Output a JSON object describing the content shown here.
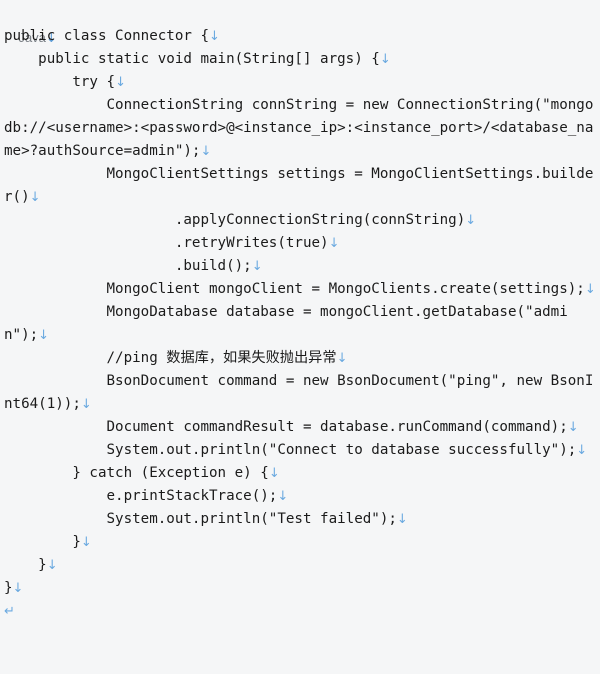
{
  "viewer": {
    "language_label": "Java",
    "background_color": "#f5f6f7",
    "text_color": "#1b1b1b",
    "newline_marker_color": "#6aa9e0",
    "newline_marker": "↓",
    "carriage_return_marker": "↵"
  },
  "code": {
    "lines": [
      "public class Connector {",
      "    public static void main(String[] args) {",
      "        try {",
      "            ConnectionString connString = new ConnectionString(\"mongodb://<username>:<password>@<instance_ip>:<instance_port>/<database_name>?authSource=admin\");",
      "            MongoClientSettings settings = MongoClientSettings.builder()",
      "                    .applyConnectionString(connString)",
      "                    .retryWrites(true)",
      "                    .build();",
      "            MongoClient mongoClient = MongoClients.create(settings);",
      "            MongoDatabase database = mongoClient.getDatabase(\"admin\");",
      "            //ping 数据库，如果失败抛出异常",
      "            BsonDocument command = new BsonDocument(\"ping\", new BsonInt64(1));",
      "            Document commandResult = database.runCommand(command);",
      "            System.out.println(\"Connect to database successfully\");",
      "        } catch (Exception e) {",
      "            e.printStackTrace();",
      "            System.out.println(\"Test failed\");",
      "        }",
      "    }",
      "}"
    ],
    "trailing_marker_line": ""
  }
}
